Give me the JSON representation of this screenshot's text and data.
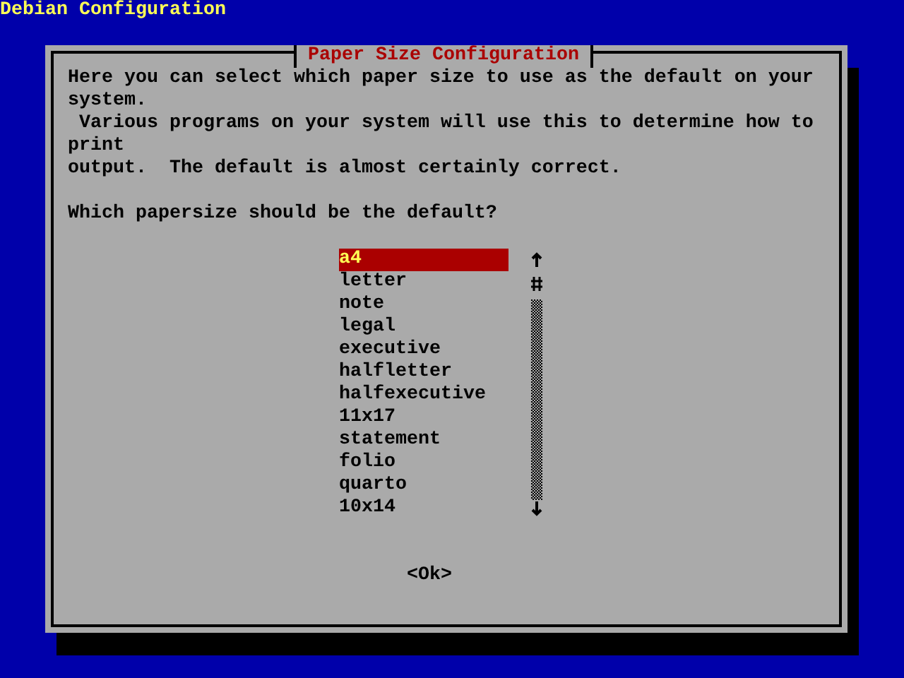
{
  "window": {
    "title": "Debian Configuration"
  },
  "dialog": {
    "title": "Paper Size Configuration",
    "description": [
      "Here you can select which paper size to use as the default on your",
      "system.",
      " Various programs on your system will use this to determine how to",
      "print",
      "output.  The default is almost certainly correct."
    ],
    "question": "Which papersize should be the default?",
    "options": [
      {
        "label": "a4",
        "selected": true
      },
      {
        "label": "letter",
        "selected": false
      },
      {
        "label": "note",
        "selected": false
      },
      {
        "label": "legal",
        "selected": false
      },
      {
        "label": "executive",
        "selected": false
      },
      {
        "label": "halfletter",
        "selected": false
      },
      {
        "label": "halfexecutive",
        "selected": false
      },
      {
        "label": "11x17",
        "selected": false
      },
      {
        "label": "statement",
        "selected": false
      },
      {
        "label": "folio",
        "selected": false
      },
      {
        "label": "quarto",
        "selected": false
      },
      {
        "label": "10x14",
        "selected": false
      }
    ],
    "buttons": [
      "<Ok>"
    ]
  }
}
